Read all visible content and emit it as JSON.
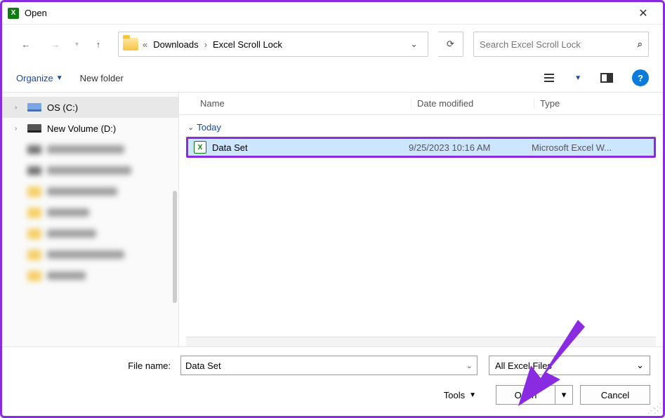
{
  "window": {
    "title": "Open"
  },
  "nav": {
    "breadcrumbs": {
      "prefix": "«",
      "b1": "Downloads",
      "sep": "›",
      "b2": "Excel Scroll Lock"
    },
    "search_placeholder": "Search Excel Scroll Lock"
  },
  "toolbar": {
    "organize": "Organize",
    "newfolder": "New folder"
  },
  "columns": {
    "name": "Name",
    "date": "Date modified",
    "type": "Type"
  },
  "group": {
    "label": "Today"
  },
  "files": [
    {
      "name": "Data Set",
      "date": "9/25/2023 10:16 AM",
      "type": "Microsoft Excel W..."
    }
  ],
  "side": {
    "drives": [
      {
        "label": "OS (C:)"
      },
      {
        "label": "New Volume (D:)"
      }
    ]
  },
  "footer": {
    "filename_label": "File name:",
    "filename_value": "Data Set",
    "filter": "All Excel Files",
    "tools": "Tools",
    "open": "Open",
    "cancel": "Cancel"
  }
}
